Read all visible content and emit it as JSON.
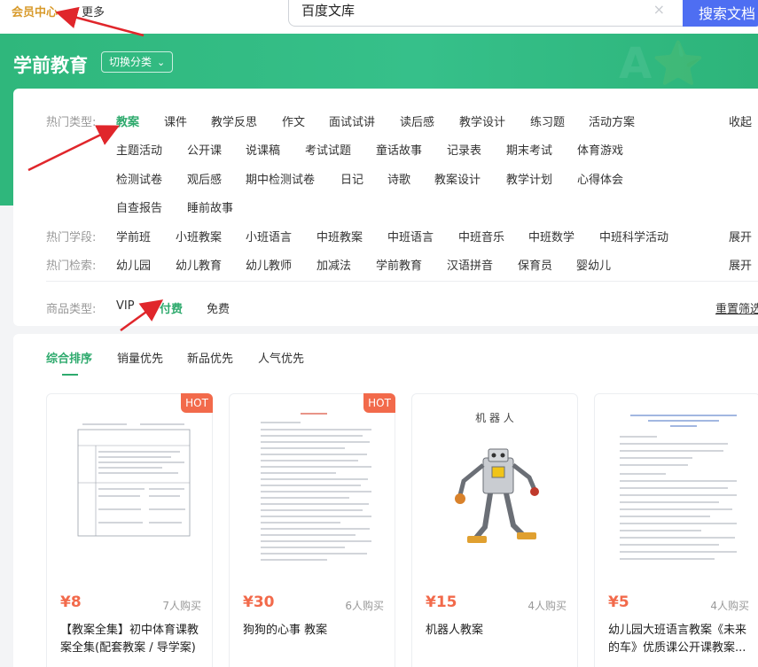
{
  "topbar": {
    "vip_center": "会员中心",
    "more": "更多",
    "search_value": "百度文库",
    "search_clear": "×",
    "search_button": "搜索文档"
  },
  "banner": {
    "title": "学前教育",
    "switch_label": "切换分类",
    "switch_chevron": "⌄",
    "decoration": "A⭐"
  },
  "filters": {
    "hot_types_label": "热门类型:",
    "hot_types": [
      "教案",
      "课件",
      "教学反思",
      "作文",
      "面试试讲",
      "读后感",
      "教学设计",
      "练习题",
      "活动方案",
      "主题活动",
      "公开课",
      "说课稿",
      "考试试题",
      "童话故事",
      "记录表",
      "期末考试",
      "体育游戏",
      "检测试卷",
      "观后感",
      "期中检测试卷",
      "日记",
      "诗歌",
      "教案设计",
      "教学计划",
      "心得体会",
      "自查报告",
      "睡前故事"
    ],
    "collapse": "收起",
    "hot_stages_label": "热门学段:",
    "hot_stages": [
      "学前班",
      "小班教案",
      "小班语言",
      "中班教案",
      "中班语言",
      "中班音乐",
      "中班数学",
      "中班科学活动"
    ],
    "expand1": "展开",
    "hot_search_label": "热门检索:",
    "hot_search": [
      "幼儿园",
      "幼儿教育",
      "幼儿教师",
      "加减法",
      "学前教育",
      "汉语拼音",
      "保育员",
      "婴幼儿"
    ],
    "expand2": "展开",
    "goods_type_label": "商品类型:",
    "goods_types": [
      "VIP",
      "付费",
      "免费"
    ],
    "reset": "重置筛选",
    "accent": "#2eaa6d"
  },
  "sort": {
    "items": [
      "综合排序",
      "销量优先",
      "新品优先",
      "人气优先"
    ]
  },
  "products": [
    {
      "hot": "HOT",
      "price": "¥8",
      "sold": "7人购买",
      "title": "【教案全集】初中体育课教案全集(配套教案 / 导学案)"
    },
    {
      "hot": "HOT",
      "price": "¥30",
      "sold": "6人购买",
      "title": "狗狗的心事 教案"
    },
    {
      "hot": "",
      "price": "¥15",
      "sold": "4人购买",
      "title": "机器人教案",
      "thumb_title": "机 器 人"
    },
    {
      "hot": "",
      "price": "¥5",
      "sold": "4人购买",
      "title": "幼儿园大班语言教案《未来的车》优质课公开课教案..."
    }
  ]
}
